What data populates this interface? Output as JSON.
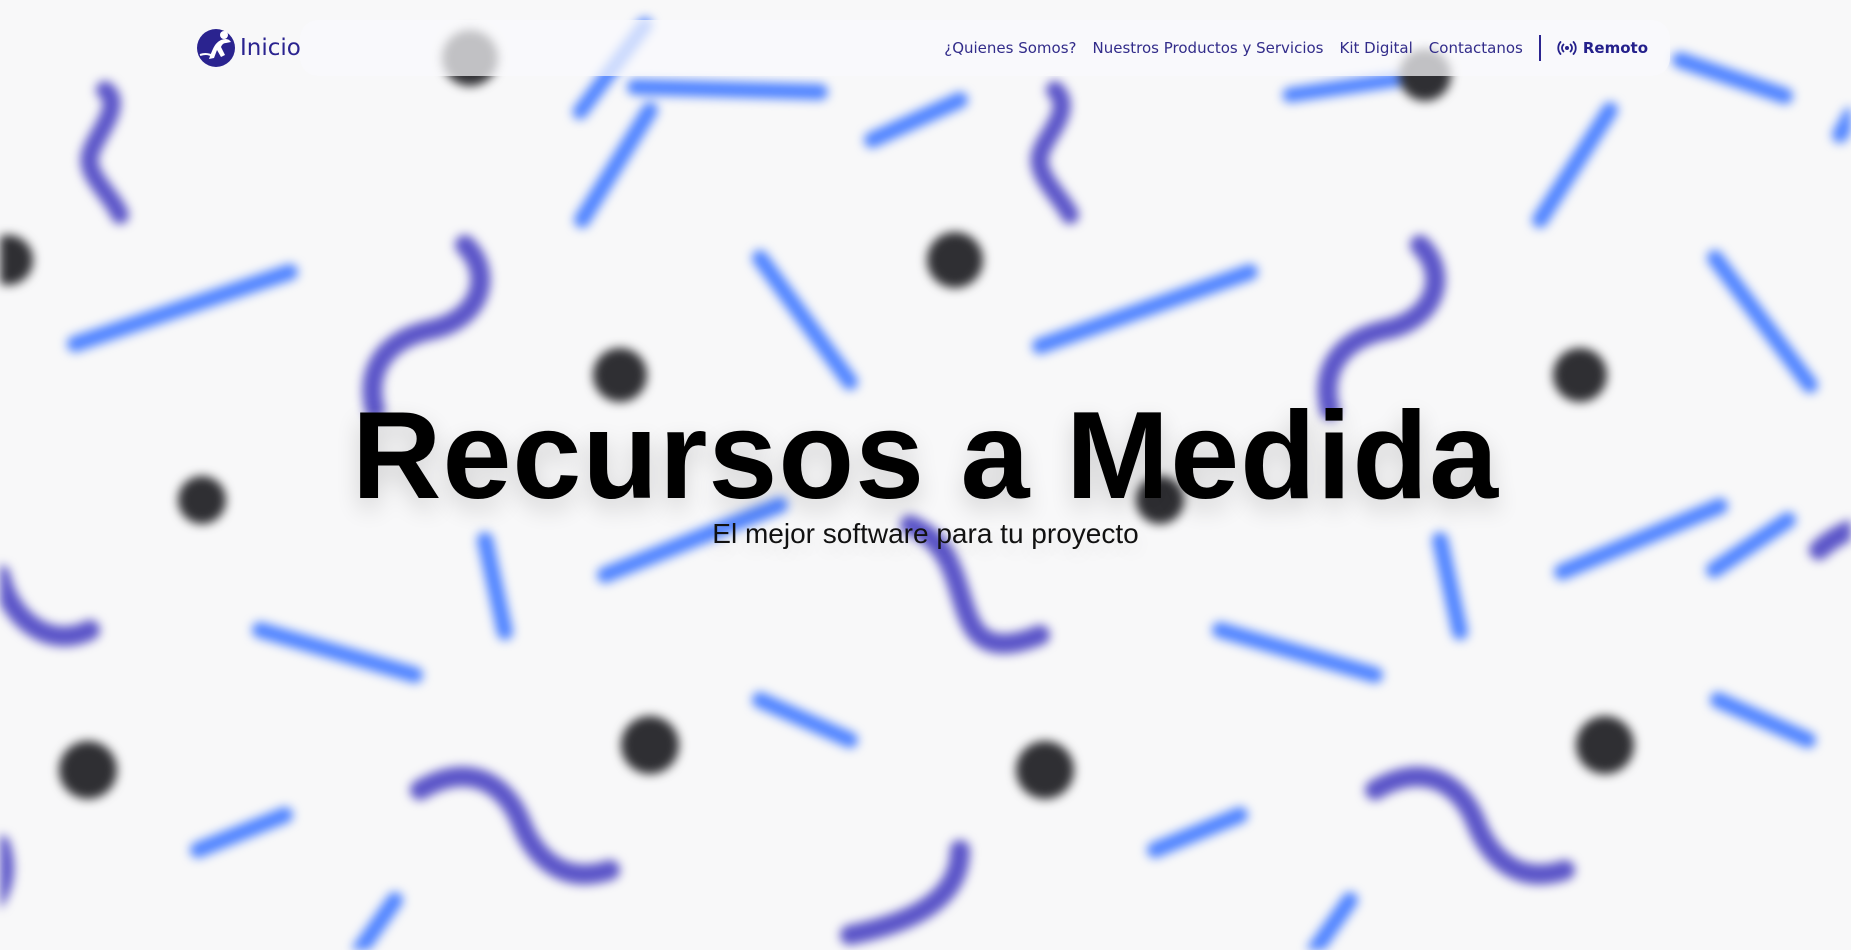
{
  "brand": {
    "logo_icon": "runner-silhouette-icon",
    "name": "Inicio",
    "color": "#2A238F"
  },
  "nav": {
    "items": [
      {
        "label": "¿Quienes Somos?"
      },
      {
        "label": "Nuestros Productos y Servicios"
      },
      {
        "label": "Kit Digital"
      },
      {
        "label": "Contactanos"
      }
    ],
    "remote_label": "Remoto",
    "remote_icon": "broadcast-icon"
  },
  "hero": {
    "title": "Recursos a Medida",
    "subtitle": "El mejor software para tu proyecto"
  },
  "colors": {
    "background": "#F8F8F9",
    "accent_blue": "#4F83FF",
    "accent_purple": "#5B55C8",
    "dark_dot": "#2F2F33"
  }
}
